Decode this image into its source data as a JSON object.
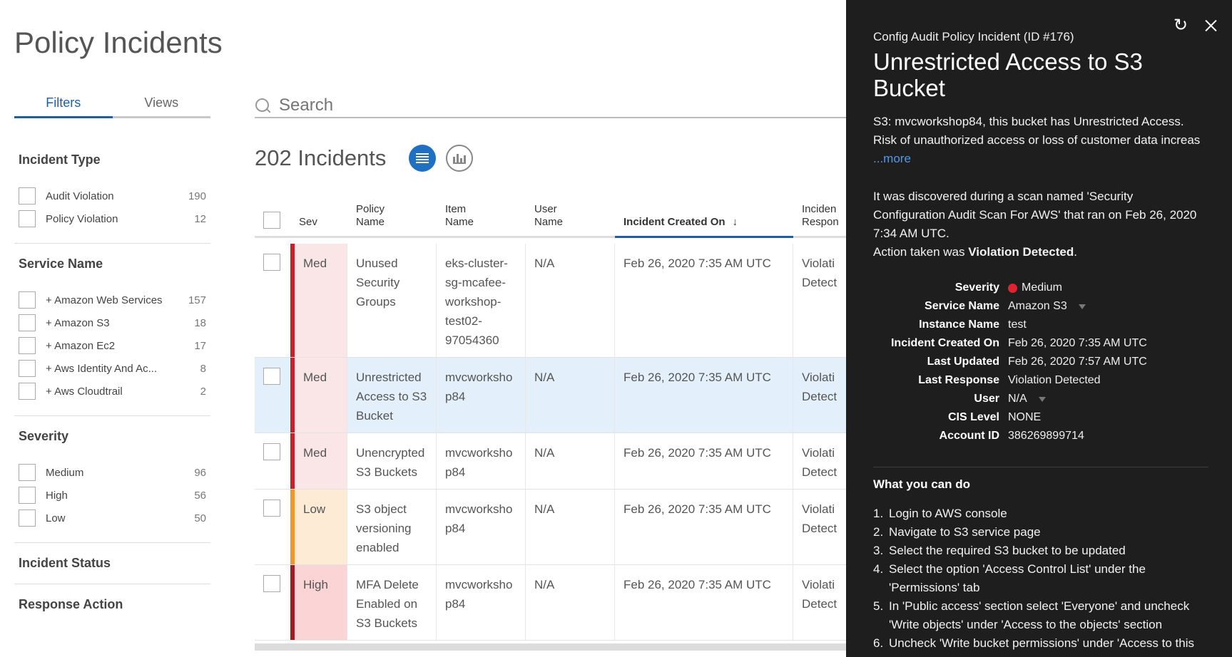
{
  "page": {
    "title": "Policy Incidents"
  },
  "filter_tabs": [
    {
      "label": "Filters"
    },
    {
      "label": "Views"
    }
  ],
  "filters": {
    "incident_type": {
      "title": "Incident Type",
      "items": [
        {
          "label": "Audit Violation",
          "count": "190"
        },
        {
          "label": "Policy Violation",
          "count": "12"
        }
      ]
    },
    "service_name": {
      "title": "Service Name",
      "items": [
        {
          "label": "+ Amazon Web Services",
          "count": "157"
        },
        {
          "label": "+ Amazon S3",
          "count": "18"
        },
        {
          "label": "+ Amazon Ec2",
          "count": "17"
        },
        {
          "label": "+ Aws Identity And Ac...",
          "count": "8"
        },
        {
          "label": "+ Aws Cloudtrail",
          "count": "2"
        }
      ]
    },
    "severity": {
      "title": "Severity",
      "items": [
        {
          "label": "Medium",
          "count": "96"
        },
        {
          "label": "High",
          "count": "56"
        },
        {
          "label": "Low",
          "count": "50"
        }
      ]
    },
    "incident_status": {
      "title": "Incident Status"
    },
    "response_action": {
      "title": "Response Action"
    }
  },
  "search": {
    "placeholder": "Search"
  },
  "incidents_count": "202 Incidents",
  "table": {
    "headers": {
      "sev": "Sev",
      "policy": [
        "Policy",
        "Name"
      ],
      "item": [
        "Item",
        "Name"
      ],
      "user": [
        "User",
        "Name"
      ],
      "date": "Incident Created On",
      "response": [
        "Inciden",
        "Respon"
      ]
    },
    "rows": [
      {
        "sev": "Med",
        "policy": "Unused Security Groups",
        "item": "eks-cluster-sg-mcafee-workshop-test02-97054360",
        "user": "N/A",
        "date": "Feb 26, 2020 7:35 AM UTC",
        "response": [
          "Violati",
          "Detect"
        ]
      },
      {
        "sev": "Med",
        "policy": "Unrestricted Access to S3 Bucket",
        "item": "mvcworkshop84",
        "user": "N/A",
        "date": "Feb 26, 2020 7:35 AM UTC",
        "response": [
          "Violati",
          "Detect"
        ]
      },
      {
        "sev": "Med",
        "policy": "Unencrypted S3 Buckets",
        "item": "mvcworkshop84",
        "user": "N/A",
        "date": "Feb 26, 2020 7:35 AM UTC",
        "response": [
          "Violati",
          "Detect"
        ]
      },
      {
        "sev": "Low",
        "policy": "S3 object versioning enabled",
        "item": "mvcworkshop84",
        "user": "N/A",
        "date": "Feb 26, 2020 7:35 AM UTC",
        "response": [
          "Violati",
          "Detect"
        ]
      },
      {
        "sev": "High",
        "policy": "MFA Delete Enabled on S3 Buckets",
        "item": "mvcworkshop84",
        "user": "N/A",
        "date": "Feb 26, 2020 7:35 AM UTC",
        "response": [
          "Violati",
          "Detect"
        ]
      }
    ]
  },
  "detail": {
    "subtitle": "Config Audit Policy Incident (ID #176)",
    "title": "Unrestricted Access to S3 Bucket",
    "description": "S3: mvcworkshop84, this bucket has Unrestricted Access. Risk of unauthorized access or loss of customer data increas",
    "more": "...more",
    "discovery": "It was discovered during a scan named 'Security Configuration Audit Scan For AWS' that ran on Feb 26, 2020 7:34 AM UTC.",
    "action_prefix": "Action taken was ",
    "action_value": "Violation Detected",
    "action_suffix": ".",
    "meta": [
      {
        "label": "Severity",
        "value": "Medium"
      },
      {
        "label": "Service Name",
        "value": "Amazon S3"
      },
      {
        "label": "Instance Name",
        "value": "test"
      },
      {
        "label": "Incident Created On",
        "value": "Feb 26, 2020 7:35 AM UTC"
      },
      {
        "label": "Last Updated",
        "value": "Feb 26, 2020 7:57 AM UTC"
      },
      {
        "label": "Last Response",
        "value": "Violation Detected"
      },
      {
        "label": "User",
        "value": "N/A"
      },
      {
        "label": "CIS Level",
        "value": "NONE"
      },
      {
        "label": "Account ID",
        "value": "386269899714"
      }
    ],
    "what_you_can_do": "What you can do",
    "steps": [
      {
        "num": "1.",
        "text": "Login to AWS console"
      },
      {
        "num": "2.",
        "text": "Navigate to S3 service page"
      },
      {
        "num": "3.",
        "text": "Select the required S3 bucket to be updated"
      },
      {
        "num": "4.",
        "text": "Select the option 'Access Control List' under the 'Permissions' tab"
      },
      {
        "num": "5.",
        "text": "In 'Public access' section select 'Everyone' and uncheck 'Write objects' under 'Access to the objects' section"
      },
      {
        "num": "6.",
        "text": "Uncheck 'Write bucket permissions' under 'Access to this"
      }
    ]
  },
  "colors": {
    "accent": "#1a5fa8",
    "med": "#c7202b",
    "low": "#f0962e",
    "high": "#9c1e24",
    "panel_bg": "#1e1e1e"
  }
}
